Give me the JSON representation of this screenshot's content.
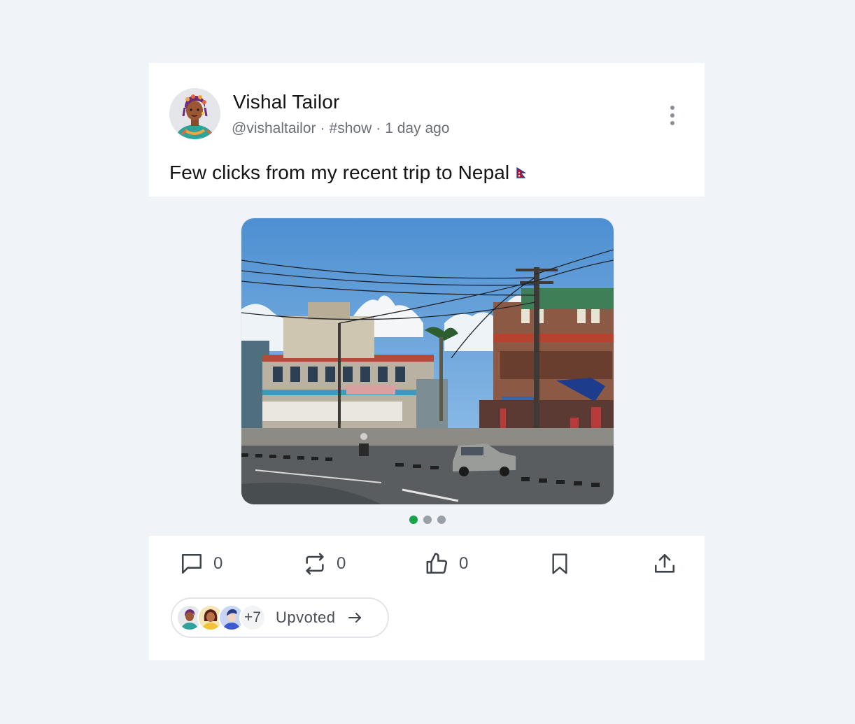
{
  "post": {
    "author_name": "Vishal Tailor",
    "handle": "@vishaltailor",
    "tag": "#show",
    "time_ago": "1 day ago",
    "separator": "·",
    "text": "Few clicks from my recent trip to Nepal",
    "flag_icon": "nepal-flag-icon"
  },
  "media": {
    "alt": "Street scene in Nepal",
    "slides_total": 3,
    "active_slide": 1
  },
  "actions": {
    "comments": "0",
    "reposts": "0",
    "likes": "0"
  },
  "upvotes": {
    "extra_count": "+7",
    "label": "Upvoted"
  },
  "colors": {
    "background": "#f0f3f8",
    "card": "#ffffff",
    "active_dot": "#16a34a",
    "inactive_dot": "#9aa0a8",
    "icon": "#3f434a"
  }
}
